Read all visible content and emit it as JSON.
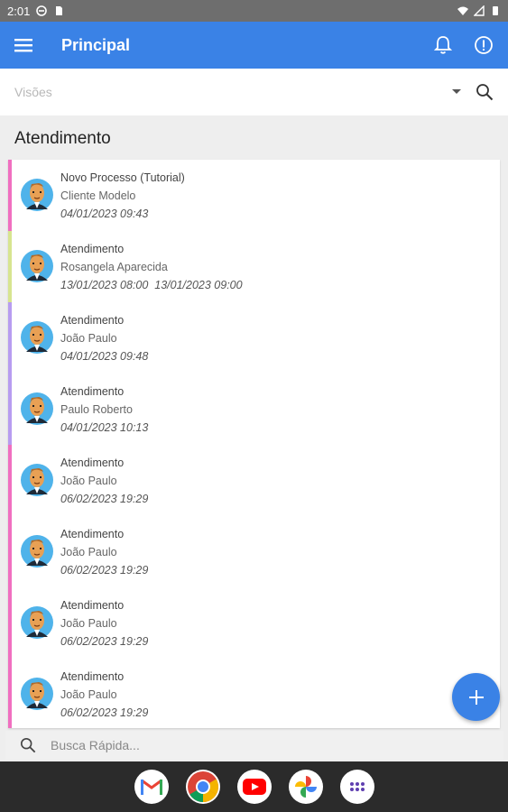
{
  "status_bar": {
    "time": "2:01"
  },
  "app_bar": {
    "title": "Principal",
    "icons": [
      "menu-icon",
      "bell-icon",
      "info-icon"
    ]
  },
  "views": {
    "placeholder": "Visões"
  },
  "section": {
    "title": "Atendimento"
  },
  "colors": {
    "primary": "#3a82e6",
    "bars": [
      "#f06fc0",
      "#d7e58f",
      "#b79cf0",
      "#b79cf0",
      "#f06fc0",
      "#f06fc0",
      "#f06fc0",
      "#f06fc0"
    ]
  },
  "items": [
    {
      "title": "Novo Processo (Tutorial)",
      "name": "Cliente Modelo",
      "date": "04/01/2023 09:43"
    },
    {
      "title": "Atendimento",
      "name": "Rosangela Aparecida",
      "date": "13/01/2023 08:00  13/01/2023 09:00"
    },
    {
      "title": "Atendimento",
      "name": "João Paulo",
      "date": "04/01/2023 09:48"
    },
    {
      "title": "Atendimento",
      "name": "Paulo Roberto",
      "date": "04/01/2023 10:13"
    },
    {
      "title": "Atendimento",
      "name": "João Paulo",
      "date": "06/02/2023 19:29"
    },
    {
      "title": "Atendimento",
      "name": "João Paulo",
      "date": "06/02/2023 19:29"
    },
    {
      "title": "Atendimento",
      "name": "João Paulo",
      "date": "06/02/2023 19:29"
    },
    {
      "title": "Atendimento",
      "name": "João Paulo",
      "date": "06/02/2023 19:29"
    }
  ],
  "quick_search": {
    "placeholder": "Busca Rápida..."
  },
  "dock": [
    "gmail-icon",
    "chrome-icon",
    "youtube-icon",
    "photos-icon",
    "app-drawer-icon"
  ]
}
